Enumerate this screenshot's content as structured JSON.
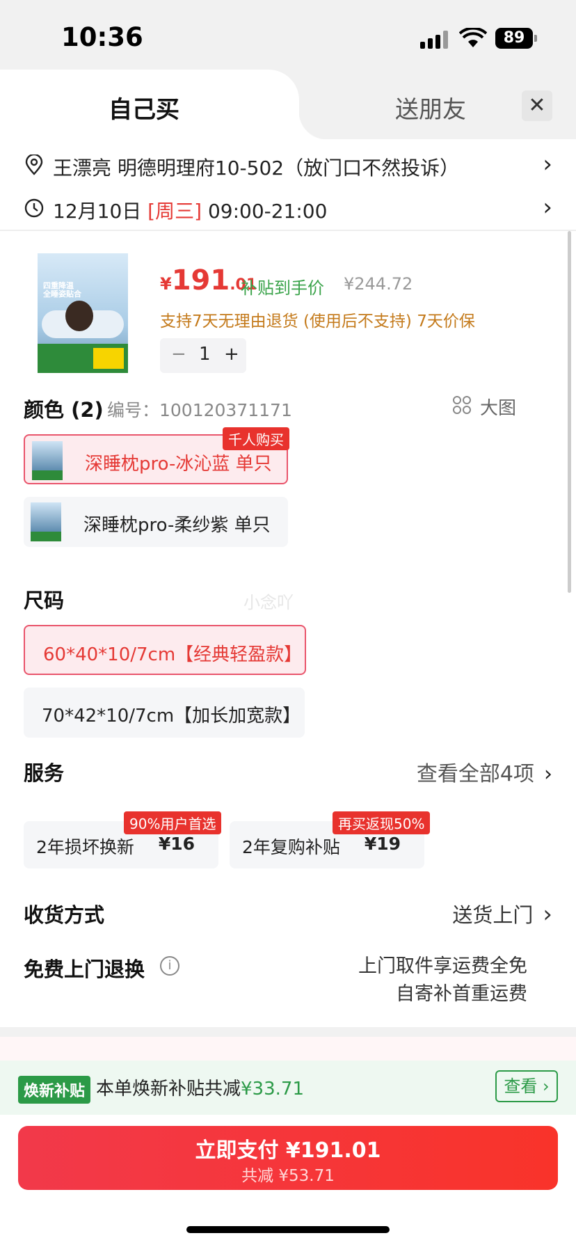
{
  "status": {
    "time": "10:36",
    "battery": "89"
  },
  "tabs": {
    "self": "自己买",
    "friend": "送朋友",
    "close": "✕"
  },
  "address": {
    "text": "王漂亮 明德明理府10-502（放门口不然投诉）"
  },
  "delivery_time": {
    "date": "12月10日",
    "weekday": "[周三]",
    "range": "09:00-21:00"
  },
  "product": {
    "img_title1": "四重降温",
    "img_title2": "全睡姿贴合",
    "price_yen": "¥",
    "price_int": "191",
    "price_dec": ".01",
    "price_tag": "补贴到手价",
    "price_old": "¥244.72",
    "support": "支持7天无理由退货 (使用后不支持)  7天价保",
    "qty_minus": "−",
    "qty": "1",
    "qty_plus": "+"
  },
  "color": {
    "title": "颜色 (2)",
    "code": "编号：100120371171",
    "bigpic": "大图",
    "options": [
      {
        "label": "深睡枕pro-冰沁蓝 单只",
        "badge": "千人购买"
      },
      {
        "label": "深睡枕pro-柔纱紫 单只"
      }
    ]
  },
  "watermark": "小念吖",
  "size": {
    "title": "尺码",
    "options": [
      {
        "label": "60*40*10/7cm【经典轻盈款】"
      },
      {
        "label": "70*42*10/7cm【加长加宽款】"
      }
    ]
  },
  "service": {
    "title": "服务",
    "see_all": "查看全部4项",
    "items": [
      {
        "name": "2年损坏换新",
        "price": "¥16",
        "badge": "90%用户首选"
      },
      {
        "name": "2年复购补贴",
        "price": "¥19",
        "badge": "再买返现50%"
      }
    ]
  },
  "shipping": {
    "title": "收货方式",
    "value": "送货上门"
  },
  "free_return": {
    "title": "免费上门退换",
    "line1": "上门取件享运费全免",
    "line2": "自寄补首重运费"
  },
  "subsidy": {
    "tag": "焕新补贴",
    "text": "本单焕新补贴共减",
    "amount": "¥33.71",
    "button": "查看"
  },
  "pay": {
    "label": "立即支付 ¥191.01",
    "sub": "共减 ¥53.71"
  },
  "colors": {
    "accent_red": "#e53935",
    "green": "#2b9a47",
    "orange": "#c47a1b"
  }
}
